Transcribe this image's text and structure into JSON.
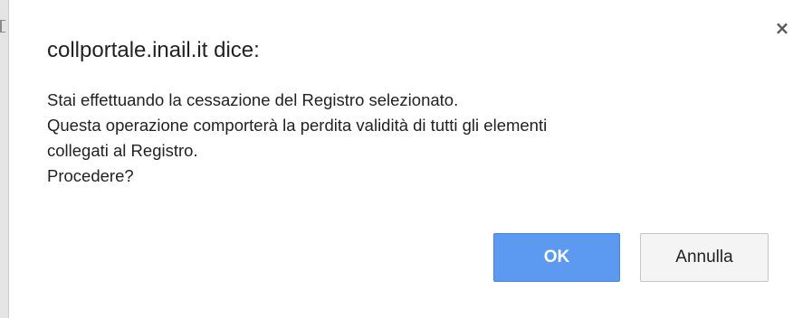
{
  "dialog": {
    "title": "collportale.inail.it dice:",
    "close_label": "×",
    "message_lines": [
      "Stai effettuando la cessazione del Registro selezionato.",
      "Questa operazione comporterà la perdita validità di tutti gli elementi",
      "collegati al Registro.",
      "Procedere?"
    ],
    "ok_label": "OK",
    "cancel_label": "Annulla"
  },
  "colors": {
    "ok_button": "#5b9af0",
    "cancel_button": "#f4f4f4",
    "text": "#222222"
  },
  "icons": {
    "close": "close-icon"
  }
}
